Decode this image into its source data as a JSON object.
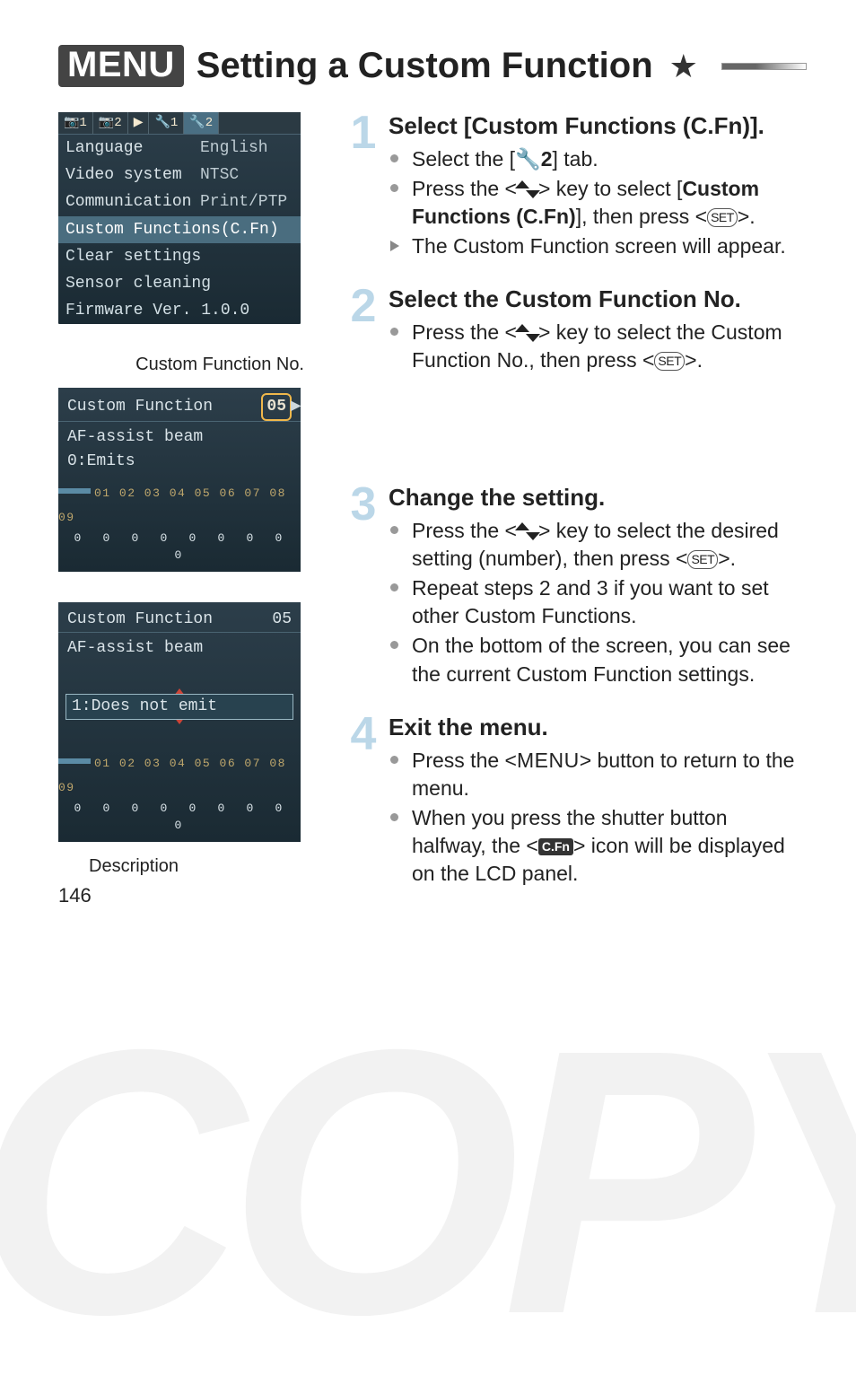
{
  "title": {
    "menu_badge": "MENU",
    "text": "Setting a Custom Function",
    "star": "★"
  },
  "lcd_menu": {
    "tabs": [
      "📷1",
      "📷2",
      "▶",
      "🔧1",
      "🔧2"
    ],
    "active_tab_index": 4,
    "rows": [
      {
        "key": "Language",
        "val": "English"
      },
      {
        "key": "Video system",
        "val": "NTSC"
      },
      {
        "key": "Communication",
        "val": "Print/PTP"
      }
    ],
    "selected_row": "Custom Functions(C.Fn)",
    "after_rows": [
      "Clear settings",
      "Sensor cleaning",
      "Firmware Ver. 1.0.0"
    ]
  },
  "left_labels": {
    "cf_no": "Custom Function No.",
    "description": "Description"
  },
  "lcd_cf1": {
    "header": "Custom Function",
    "number": "05",
    "line1": "AF-assist beam",
    "line2": "0:Emits",
    "index_row": "01 02 03 04 05 06 07 08 09",
    "value_row": "0 0 0 0 0 0 0 0 0"
  },
  "lcd_cf2": {
    "header": "Custom Function",
    "number": "05",
    "line1": "AF-assist beam",
    "sel": "1:Does not emit",
    "index_row": "01 02 03 04 05 06 07 08 09",
    "value_row": "0 0 0 0 0 0 0 0 0"
  },
  "steps": {
    "s1": {
      "num": "1",
      "title": "Select [Custom Functions (C.Fn)].",
      "b1a": "Select the [",
      "b1_tab": "🔧2",
      "b1b": "] tab.",
      "b2a": "Press the <",
      "b2b": "> key to select [",
      "b2bold": "Custom Functions (C.Fn)",
      "b2c": "], then press <",
      "set": "SET",
      "b2d": ">.",
      "b3": "The Custom Function screen will appear."
    },
    "s2": {
      "num": "2",
      "title": "Select the Custom Function No.",
      "b1a": "Press the <",
      "b1b": "> key to select the Custom Function No., then press <",
      "set": "SET",
      "b1c": ">."
    },
    "s3": {
      "num": "3",
      "title": "Change the setting.",
      "b1a": "Press the <",
      "b1b": "> key to select the desired setting (number), then press <",
      "set": "SET",
      "b1c": ">.",
      "b2": "Repeat steps 2 and 3 if you want to set other Custom Functions.",
      "b3": "On the bottom of the screen, you can see the current Custom Function settings."
    },
    "s4": {
      "num": "4",
      "title": "Exit the menu.",
      "b1a": "Press the <",
      "menu": "MENU",
      "b1b": "> button to return to the menu.",
      "b2a": "When you press the shutter button halfway, the <",
      "cfn": "C.Fn",
      "b2b": "> icon will be displayed on the LCD panel."
    }
  },
  "page_number": "146"
}
